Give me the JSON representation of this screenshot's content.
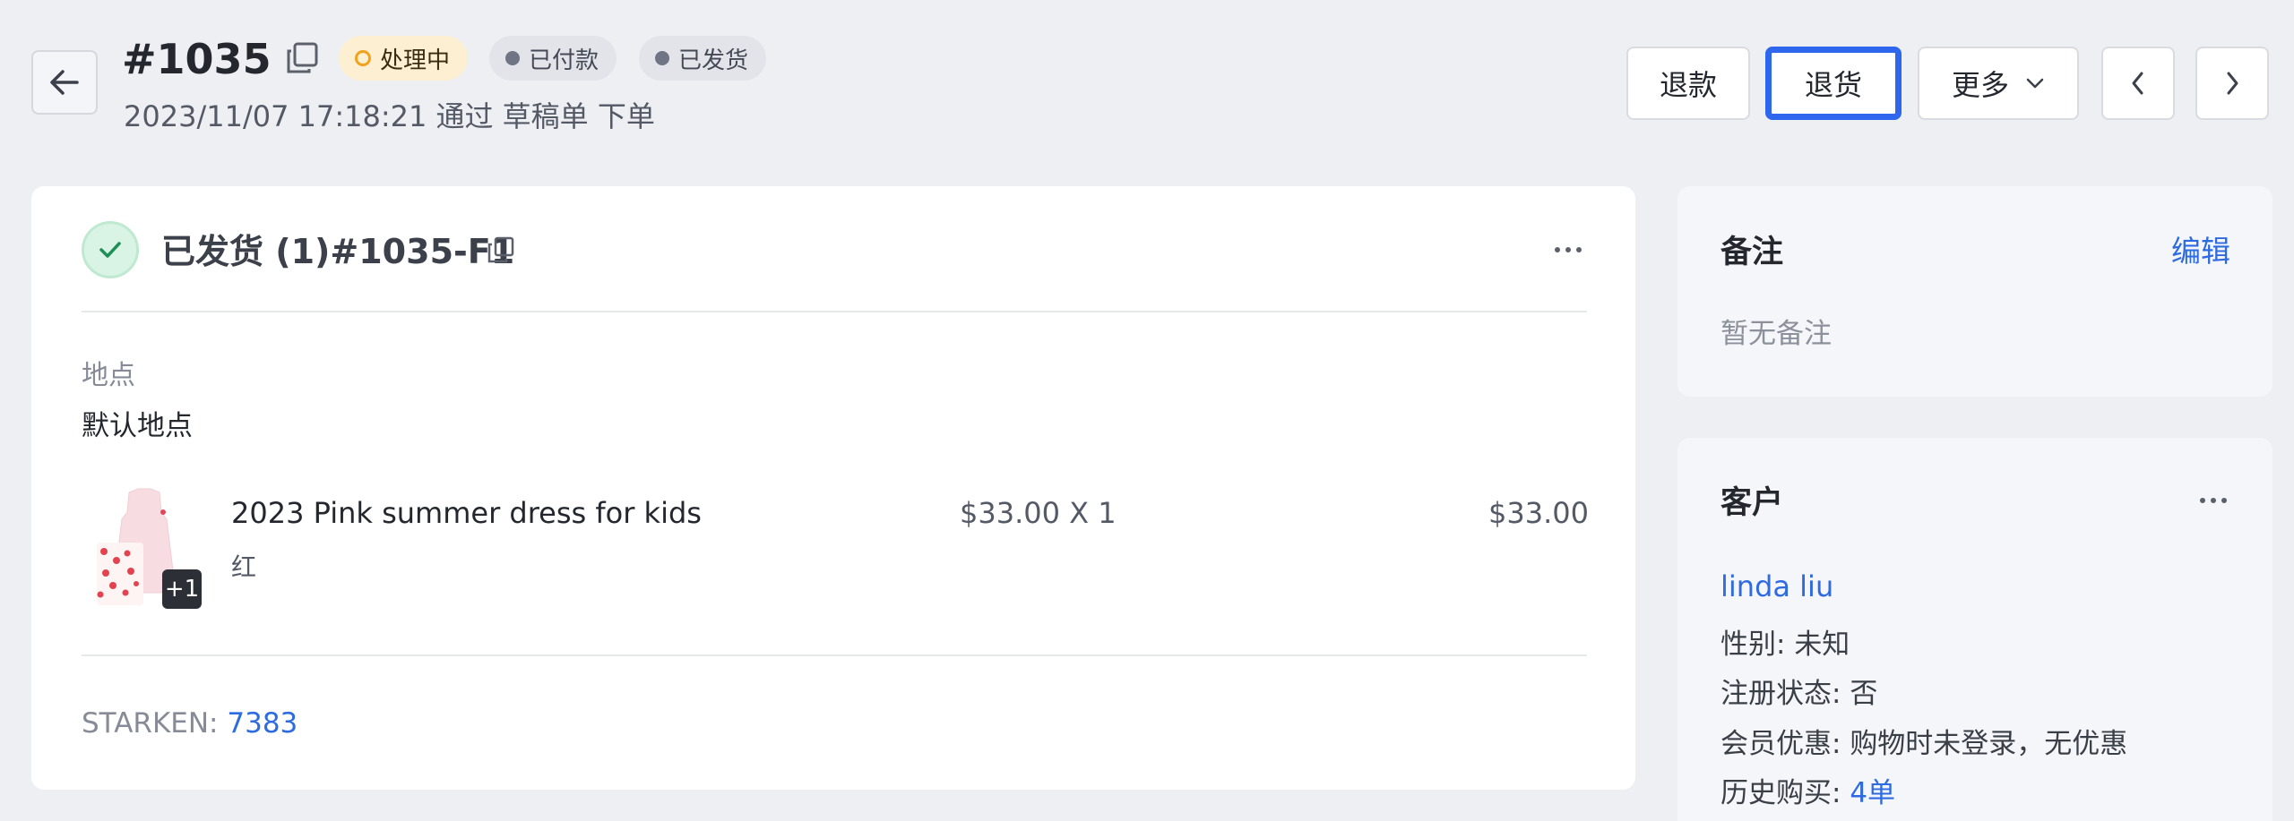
{
  "header": {
    "order_number": "#1035",
    "badges": {
      "processing": "处理中",
      "paid": "已付款",
      "shipped": "已发货"
    },
    "subtitle": "2023/11/07 17:18:21 通过 草稿单 下单",
    "buttons": {
      "refund": "退款",
      "return": "退货",
      "more": "更多"
    },
    "colors": {
      "accent": "#2e66ee",
      "processing_dot": "#f2a21c",
      "processing_bg": "#fcefd2"
    }
  },
  "fulfillment": {
    "title": "已发货 (1)#1035-F1",
    "location_label": "地点",
    "location_value": "默认地点",
    "product": {
      "name": "2023 Pink summer dress for kids",
      "variant": "红",
      "price_qty": "$33.00 X 1",
      "total": "$33.00",
      "extra_images": "+1"
    },
    "carrier_label": "STARKEN:",
    "tracking_number": "7383"
  },
  "notes": {
    "title": "备注",
    "edit": "编辑",
    "empty": "暂无备注"
  },
  "customer": {
    "title": "客户",
    "name": "linda liu",
    "gender_label": "性别:",
    "gender_value": "未知",
    "registration_label": "注册状态:",
    "registration_value": "否",
    "member_label": "会员优惠:",
    "member_value": "购物时未登录，无优惠",
    "history_label": "历史购买:",
    "history_value": "4单"
  }
}
